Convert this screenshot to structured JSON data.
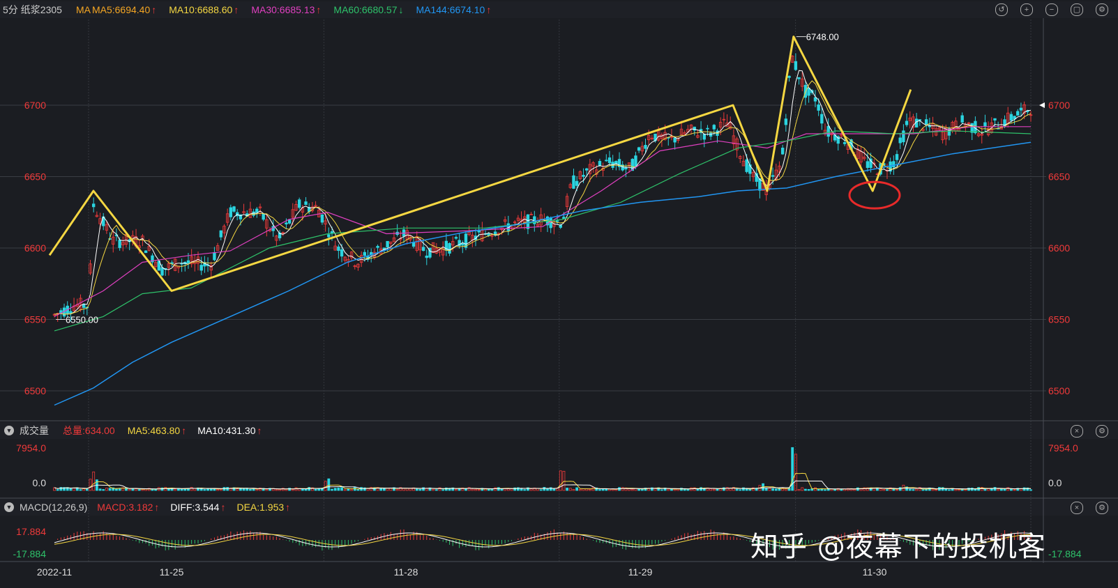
{
  "header": {
    "period": "5分",
    "symbol": "纸浆2305",
    "ma_label": "MA",
    "ma": [
      {
        "text": "MA5:6694.40",
        "color": "#f5a623",
        "dir": "up"
      },
      {
        "text": "MA10:6688.60",
        "color": "#f5d742",
        "dir": "up"
      },
      {
        "text": "MA30:6685.13",
        "color": "#e040c0",
        "dir": "up"
      },
      {
        "text": "MA60:6680.57",
        "color": "#2ec26a",
        "dir": "down"
      },
      {
        "text": "MA144:6674.10",
        "color": "#2196f3",
        "dir": "up"
      }
    ]
  },
  "volume_header": {
    "title": "成交量",
    "total": "总量:634.00",
    "ma5": "MA5:463.80",
    "ma10": "MA10:431.30"
  },
  "macd_header": {
    "title": "MACD(12,26,9)",
    "macd": "MACD:3.182",
    "diff": "DIFF:3.544",
    "dea": "DEA:1.953"
  },
  "watermark": "知乎 @夜幕下的投机客",
  "colors": {
    "up": "#f03a3a",
    "down": "#2bd4e0",
    "ma5": "#ffffff",
    "ma10": "#f5d742",
    "ma30": "#e040c0",
    "ma60": "#2ec26a",
    "ma144": "#2196f3",
    "zigzag": "#f5d742"
  },
  "chart_data": {
    "type": "candlestick",
    "ylim": [
      6480,
      6760
    ],
    "yticks": [
      "6500",
      "6550",
      "6600",
      "6650",
      "6700"
    ],
    "xticks": [
      {
        "label": "2022-11",
        "pos": 0.0
      },
      {
        "label": "11-25",
        "pos": 0.12
      },
      {
        "label": "11-28",
        "pos": 0.36
      },
      {
        "label": "11-29",
        "pos": 0.6
      },
      {
        "label": "11-30",
        "pos": 0.84
      }
    ],
    "annotations": [
      {
        "text": "6748.00",
        "value": 6748
      },
      {
        "text": "6550.00",
        "value": 6550
      }
    ],
    "last_price": "6700",
    "zigzag": [
      {
        "t": -0.005,
        "v": 6595
      },
      {
        "t": 0.04,
        "v": 6640
      },
      {
        "t": 0.12,
        "v": 6570
      },
      {
        "t": 0.695,
        "v": 6700
      },
      {
        "t": 0.73,
        "v": 6640
      },
      {
        "t": 0.757,
        "v": 6748
      },
      {
        "t": 0.838,
        "v": 6640
      },
      {
        "t": 0.877,
        "v": 6711
      }
    ],
    "circle": {
      "t": 0.84,
      "v": 6637
    },
    "price_path": [
      {
        "t": 0.0,
        "v": 6553
      },
      {
        "t": 0.02,
        "v": 6560
      },
      {
        "t": 0.035,
        "v": 6560
      },
      {
        "t": 0.04,
        "v": 6630
      },
      {
        "t": 0.06,
        "v": 6605
      },
      {
        "t": 0.09,
        "v": 6605
      },
      {
        "t": 0.11,
        "v": 6585
      },
      {
        "t": 0.13,
        "v": 6590
      },
      {
        "t": 0.16,
        "v": 6588
      },
      {
        "t": 0.18,
        "v": 6625
      },
      {
        "t": 0.21,
        "v": 6625
      },
      {
        "t": 0.23,
        "v": 6605
      },
      {
        "t": 0.25,
        "v": 6630
      },
      {
        "t": 0.27,
        "v": 6628
      },
      {
        "t": 0.29,
        "v": 6600
      },
      {
        "t": 0.31,
        "v": 6590
      },
      {
        "t": 0.33,
        "v": 6598
      },
      {
        "t": 0.36,
        "v": 6610
      },
      {
        "t": 0.38,
        "v": 6598
      },
      {
        "t": 0.4,
        "v": 6600
      },
      {
        "t": 0.42,
        "v": 6605
      },
      {
        "t": 0.44,
        "v": 6610
      },
      {
        "t": 0.46,
        "v": 6615
      },
      {
        "t": 0.48,
        "v": 6618
      },
      {
        "t": 0.5,
        "v": 6620
      },
      {
        "t": 0.52,
        "v": 6618
      },
      {
        "t": 0.53,
        "v": 6645
      },
      {
        "t": 0.55,
        "v": 6655
      },
      {
        "t": 0.57,
        "v": 6660
      },
      {
        "t": 0.59,
        "v": 6655
      },
      {
        "t": 0.61,
        "v": 6680
      },
      {
        "t": 0.63,
        "v": 6675
      },
      {
        "t": 0.65,
        "v": 6682
      },
      {
        "t": 0.67,
        "v": 6680
      },
      {
        "t": 0.69,
        "v": 6688
      },
      {
        "t": 0.7,
        "v": 6670
      },
      {
        "t": 0.715,
        "v": 6650
      },
      {
        "t": 0.73,
        "v": 6640
      },
      {
        "t": 0.745,
        "v": 6660
      },
      {
        "t": 0.755,
        "v": 6735
      },
      {
        "t": 0.77,
        "v": 6708
      },
      {
        "t": 0.78,
        "v": 6705
      },
      {
        "t": 0.79,
        "v": 6682
      },
      {
        "t": 0.81,
        "v": 6676
      },
      {
        "t": 0.83,
        "v": 6660
      },
      {
        "t": 0.845,
        "v": 6655
      },
      {
        "t": 0.86,
        "v": 6660
      },
      {
        "t": 0.875,
        "v": 6690
      },
      {
        "t": 0.89,
        "v": 6686
      },
      {
        "t": 0.91,
        "v": 6680
      },
      {
        "t": 0.93,
        "v": 6688
      },
      {
        "t": 0.95,
        "v": 6682
      },
      {
        "t": 0.97,
        "v": 6688
      },
      {
        "t": 1.0,
        "v": 6698
      }
    ],
    "ma144_path": [
      {
        "t": 0.0,
        "v": 6490
      },
      {
        "t": 0.04,
        "v": 6502
      },
      {
        "t": 0.08,
        "v": 6520
      },
      {
        "t": 0.12,
        "v": 6534
      },
      {
        "t": 0.18,
        "v": 6552
      },
      {
        "t": 0.24,
        "v": 6570
      },
      {
        "t": 0.3,
        "v": 6590
      },
      {
        "t": 0.36,
        "v": 6603
      },
      {
        "t": 0.42,
        "v": 6611
      },
      {
        "t": 0.48,
        "v": 6617
      },
      {
        "t": 0.54,
        "v": 6626
      },
      {
        "t": 0.6,
        "v": 6632
      },
      {
        "t": 0.66,
        "v": 6636
      },
      {
        "t": 0.7,
        "v": 6640
      },
      {
        "t": 0.75,
        "v": 6642
      },
      {
        "t": 0.8,
        "v": 6650
      },
      {
        "t": 0.86,
        "v": 6658
      },
      {
        "t": 0.92,
        "v": 6666
      },
      {
        "t": 1.0,
        "v": 6674
      }
    ],
    "ma60_path": [
      {
        "t": 0.0,
        "v": 6542
      },
      {
        "t": 0.05,
        "v": 6552
      },
      {
        "t": 0.09,
        "v": 6568
      },
      {
        "t": 0.14,
        "v": 6572
      },
      {
        "t": 0.22,
        "v": 6600
      },
      {
        "t": 0.28,
        "v": 6610
      },
      {
        "t": 0.36,
        "v": 6614
      },
      {
        "t": 0.44,
        "v": 6614
      },
      {
        "t": 0.52,
        "v": 6620
      },
      {
        "t": 0.58,
        "v": 6632
      },
      {
        "t": 0.64,
        "v": 6652
      },
      {
        "t": 0.7,
        "v": 6670
      },
      {
        "t": 0.75,
        "v": 6675
      },
      {
        "t": 0.8,
        "v": 6682
      },
      {
        "t": 0.86,
        "v": 6680
      },
      {
        "t": 0.92,
        "v": 6682
      },
      {
        "t": 1.0,
        "v": 6680
      }
    ],
    "ma30_path": [
      {
        "t": 0.0,
        "v": 6552
      },
      {
        "t": 0.05,
        "v": 6570
      },
      {
        "t": 0.09,
        "v": 6590
      },
      {
        "t": 0.14,
        "v": 6595
      },
      {
        "t": 0.18,
        "v": 6598
      },
      {
        "t": 0.24,
        "v": 6620
      },
      {
        "t": 0.28,
        "v": 6625
      },
      {
        "t": 0.34,
        "v": 6610
      },
      {
        "t": 0.42,
        "v": 6612
      },
      {
        "t": 0.5,
        "v": 6615
      },
      {
        "t": 0.56,
        "v": 6640
      },
      {
        "t": 0.62,
        "v": 6668
      },
      {
        "t": 0.68,
        "v": 6675
      },
      {
        "t": 0.73,
        "v": 6670
      },
      {
        "t": 0.77,
        "v": 6680
      },
      {
        "t": 0.83,
        "v": 6680
      },
      {
        "t": 0.88,
        "v": 6680
      },
      {
        "t": 0.94,
        "v": 6685
      },
      {
        "t": 1.0,
        "v": 6685
      }
    ],
    "volume": {
      "ymax": 7954,
      "ticks": [
        "7954.0",
        "0.0"
      ],
      "spikes": [
        {
          "t": 0.04,
          "v": 3000
        },
        {
          "t": 0.28,
          "v": 2100
        },
        {
          "t": 0.52,
          "v": 3900
        },
        {
          "t": 0.725,
          "v": 1200
        },
        {
          "t": 0.757,
          "v": 7954
        },
        {
          "t": 0.87,
          "v": 900
        }
      ]
    },
    "macd": {
      "ticks": [
        "17.884",
        "-17.884"
      ]
    }
  }
}
